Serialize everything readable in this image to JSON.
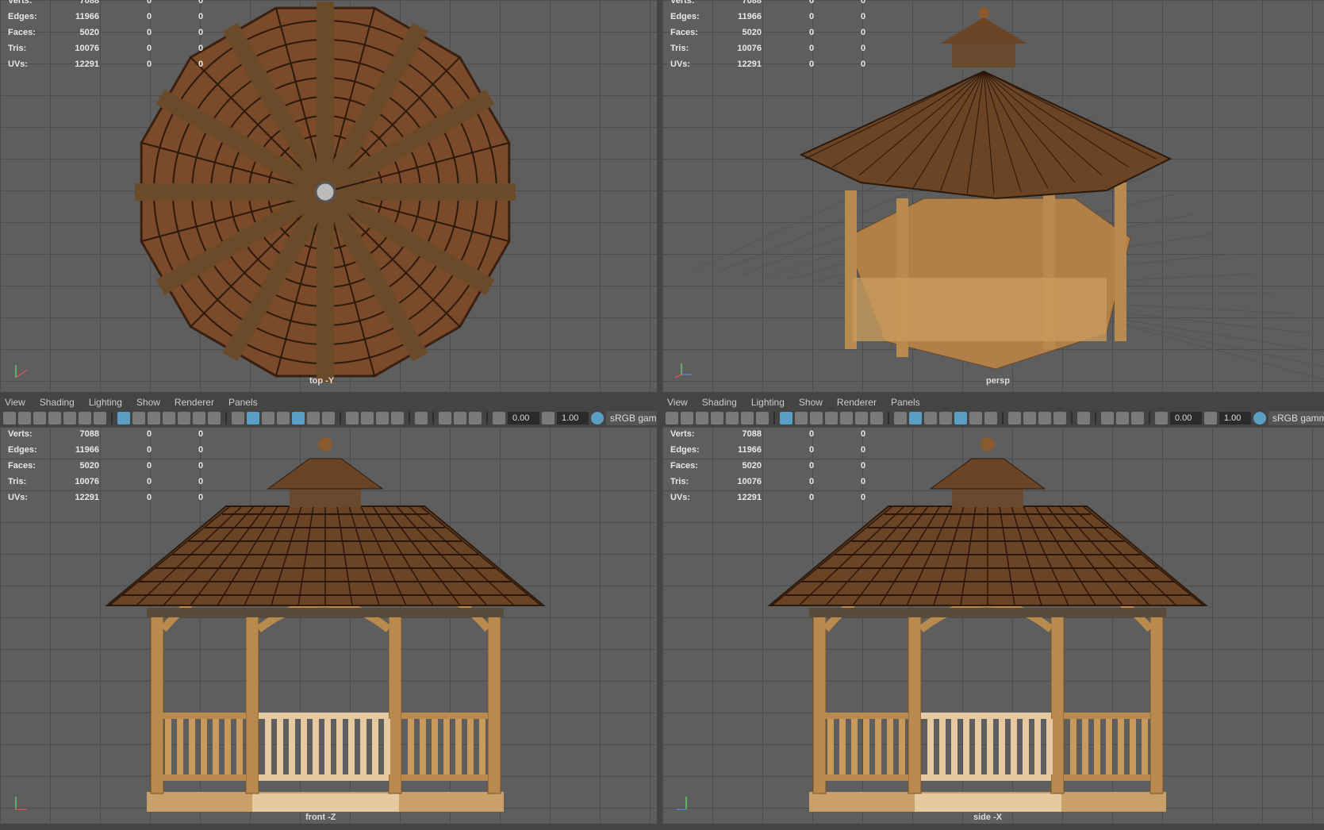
{
  "menu": [
    "View",
    "Shading",
    "Lighting",
    "Show",
    "Renderer",
    "Panels"
  ],
  "stats": [
    {
      "label": "Verts:",
      "value": "7088",
      "a": "0",
      "b": "0"
    },
    {
      "label": "Edges:",
      "value": "11966",
      "a": "0",
      "b": "0"
    },
    {
      "label": "Faces:",
      "value": "5020",
      "a": "0",
      "b": "0"
    },
    {
      "label": "Tris:",
      "value": "10076",
      "a": "0",
      "b": "0"
    },
    {
      "label": "UVs:",
      "value": "12291",
      "a": "0",
      "b": "0"
    }
  ],
  "viewports": {
    "top": "top -Y",
    "persp": "persp",
    "front": "front -Z",
    "side": "side -X"
  },
  "toolbar": {
    "exposure": "0.00",
    "gamma": "1.00",
    "color_space": "sRGB gamm"
  },
  "colors": {
    "viewport_bg": "#5e5e5e",
    "accent": "#5a9ec4",
    "wood": "#b98a4e",
    "roof": "#6b4426"
  }
}
